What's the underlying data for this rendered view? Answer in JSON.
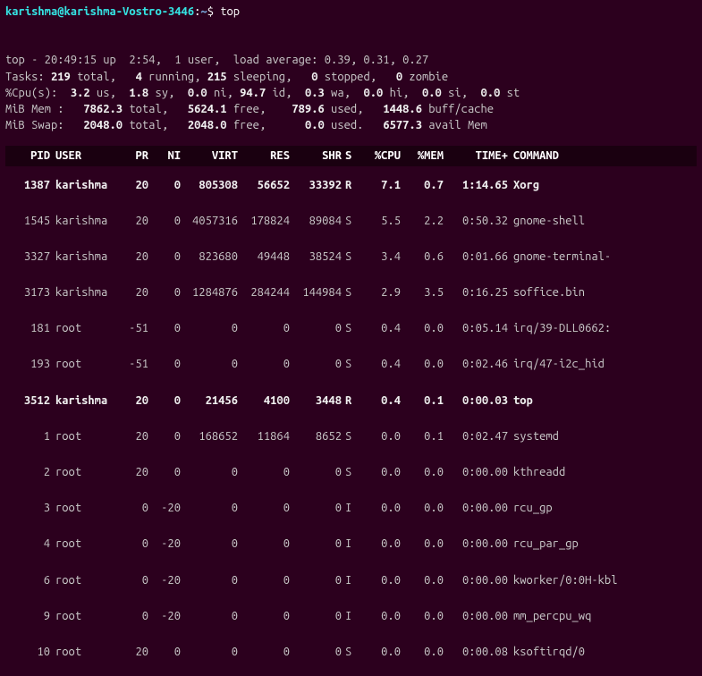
{
  "prompt": {
    "user_host": "karishma@karishma-Vostro-3446",
    "path": "~",
    "command": "top"
  },
  "summary": {
    "line1_a": "top - 20:49:15 up  2:54,  1 user,  load average: 0.39, 0.31, 0.27",
    "tasks_label": "Tasks:",
    "tasks_total": "219",
    "tasks_total_t": " total,   ",
    "tasks_running": "4",
    "tasks_running_t": " running, ",
    "tasks_sleeping": "215",
    "tasks_sleeping_t": " sleeping,   ",
    "tasks_stopped": "0",
    "tasks_stopped_t": " stopped,   ",
    "tasks_zombie": "0",
    "tasks_zombie_t": " zombie",
    "cpu_label": "%Cpu(s):  ",
    "cpu_us": "3.2",
    "cpu_us_t": " us,  ",
    "cpu_sy": "1.8",
    "cpu_sy_t": " sy,  ",
    "cpu_ni": "0.0",
    "cpu_ni_t": " ni, ",
    "cpu_id": "94.7",
    "cpu_id_t": " id,  ",
    "cpu_wa": "0.3",
    "cpu_wa_t": " wa,  ",
    "cpu_hi": "0.0",
    "cpu_hi_t": " hi,  ",
    "cpu_si": "0.0",
    "cpu_si_t": " si,  ",
    "cpu_st": "0.0",
    "cpu_st_t": " st",
    "mem_label": "MiB Mem :   ",
    "mem_total": "7862.3",
    "mem_total_t": " total,   ",
    "mem_free": "5624.1",
    "mem_free_t": " free,    ",
    "mem_used": "789.6",
    "mem_used_t": " used,   ",
    "mem_buff": "1448.6",
    "mem_buff_t": " buff/cache",
    "swap_label": "MiB Swap:   ",
    "swap_total": "2048.0",
    "swap_total_t": " total,   ",
    "swap_free": "2048.0",
    "swap_free_t": " free,      ",
    "swap_used": "0.0",
    "swap_used_t": " used.   ",
    "swap_avail": "6577.3",
    "swap_avail_t": " avail Mem"
  },
  "headers": {
    "pid": "PID",
    "user": "USER",
    "pr": "PR",
    "ni": "NI",
    "virt": "VIRT",
    "res": "RES",
    "shr": "SHR",
    "s": "S",
    "cpu": "%CPU",
    "mem": "%MEM",
    "time": "TIME+",
    "command": "COMMAND"
  },
  "procs": [
    {
      "pid": "1387",
      "user": "karishma",
      "pr": "20",
      "ni": "0",
      "virt": "805308",
      "res": "56652",
      "shr": "33392",
      "s": "R",
      "cpu": "7.1",
      "mem": "0.7",
      "time": "1:14.65",
      "cmd": "Xorg",
      "bold": true
    },
    {
      "pid": "1545",
      "user": "karishma",
      "pr": "20",
      "ni": "0",
      "virt": "4057316",
      "res": "178824",
      "shr": "89084",
      "s": "S",
      "cpu": "5.5",
      "mem": "2.2",
      "time": "0:50.32",
      "cmd": "gnome-shell",
      "bold": false
    },
    {
      "pid": "3327",
      "user": "karishma",
      "pr": "20",
      "ni": "0",
      "virt": "823680",
      "res": "49448",
      "shr": "38524",
      "s": "S",
      "cpu": "3.4",
      "mem": "0.6",
      "time": "0:01.66",
      "cmd": "gnome-terminal-",
      "bold": false
    },
    {
      "pid": "3173",
      "user": "karishma",
      "pr": "20",
      "ni": "0",
      "virt": "1284876",
      "res": "284244",
      "shr": "144984",
      "s": "S",
      "cpu": "2.9",
      "mem": "3.5",
      "time": "0:16.25",
      "cmd": "soffice.bin",
      "bold": false
    },
    {
      "pid": "181",
      "user": "root",
      "pr": "-51",
      "ni": "0",
      "virt": "0",
      "res": "0",
      "shr": "0",
      "s": "S",
      "cpu": "0.4",
      "mem": "0.0",
      "time": "0:05.14",
      "cmd": "irq/39-DLL0662:",
      "bold": false
    },
    {
      "pid": "193",
      "user": "root",
      "pr": "-51",
      "ni": "0",
      "virt": "0",
      "res": "0",
      "shr": "0",
      "s": "S",
      "cpu": "0.4",
      "mem": "0.0",
      "time": "0:02.46",
      "cmd": "irq/47-i2c_hid",
      "bold": false
    },
    {
      "pid": "3512",
      "user": "karishma",
      "pr": "20",
      "ni": "0",
      "virt": "21456",
      "res": "4100",
      "shr": "3448",
      "s": "R",
      "cpu": "0.4",
      "mem": "0.1",
      "time": "0:00.03",
      "cmd": "top",
      "bold": true
    },
    {
      "pid": "1",
      "user": "root",
      "pr": "20",
      "ni": "0",
      "virt": "168652",
      "res": "11864",
      "shr": "8652",
      "s": "S",
      "cpu": "0.0",
      "mem": "0.1",
      "time": "0:02.47",
      "cmd": "systemd",
      "bold": false
    },
    {
      "pid": "2",
      "user": "root",
      "pr": "20",
      "ni": "0",
      "virt": "0",
      "res": "0",
      "shr": "0",
      "s": "S",
      "cpu": "0.0",
      "mem": "0.0",
      "time": "0:00.00",
      "cmd": "kthreadd",
      "bold": false
    },
    {
      "pid": "3",
      "user": "root",
      "pr": "0",
      "ni": "-20",
      "virt": "0",
      "res": "0",
      "shr": "0",
      "s": "I",
      "cpu": "0.0",
      "mem": "0.0",
      "time": "0:00.00",
      "cmd": "rcu_gp",
      "bold": false
    },
    {
      "pid": "4",
      "user": "root",
      "pr": "0",
      "ni": "-20",
      "virt": "0",
      "res": "0",
      "shr": "0",
      "s": "I",
      "cpu": "0.0",
      "mem": "0.0",
      "time": "0:00.00",
      "cmd": "rcu_par_gp",
      "bold": false
    },
    {
      "pid": "6",
      "user": "root",
      "pr": "0",
      "ni": "-20",
      "virt": "0",
      "res": "0",
      "shr": "0",
      "s": "I",
      "cpu": "0.0",
      "mem": "0.0",
      "time": "0:00.00",
      "cmd": "kworker/0:0H-kbl",
      "bold": false
    },
    {
      "pid": "9",
      "user": "root",
      "pr": "0",
      "ni": "-20",
      "virt": "0",
      "res": "0",
      "shr": "0",
      "s": "I",
      "cpu": "0.0",
      "mem": "0.0",
      "time": "0:00.00",
      "cmd": "mm_percpu_wq",
      "bold": false
    },
    {
      "pid": "10",
      "user": "root",
      "pr": "20",
      "ni": "0",
      "virt": "0",
      "res": "0",
      "shr": "0",
      "s": "S",
      "cpu": "0.0",
      "mem": "0.0",
      "time": "0:00.08",
      "cmd": "ksoftirqd/0",
      "bold": false
    }
  ]
}
